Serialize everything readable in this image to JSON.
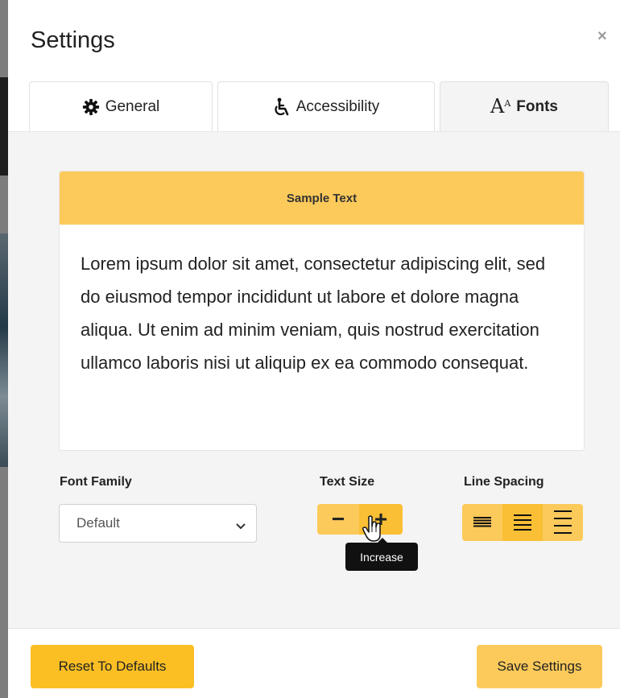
{
  "modal": {
    "title": "Settings",
    "close_label": "×"
  },
  "tabs": [
    {
      "label": "General",
      "icon": "gear-icon",
      "active": false
    },
    {
      "label": "Accessibility",
      "icon": "wheelchair-icon",
      "active": false
    },
    {
      "label": "Fonts",
      "icon": "font-size-icon",
      "active": true
    }
  ],
  "fonts_tab": {
    "icon_glyph_main": "A",
    "icon_glyph_sup": "A",
    "sample": {
      "header": "Sample Text",
      "body": "Lorem ipsum dolor sit amet, consectetur adipiscing elit, sed do eiusmod tempor incididunt ut labore et dolore magna aliqua. Ut enim ad minim veniam, quis nostrud exercitation ullamco laboris nisi ut aliquip ex ea commodo consequat."
    },
    "font_family": {
      "label": "Font Family",
      "value": "Default"
    },
    "text_size": {
      "label": "Text Size",
      "decrease": "−",
      "increase": "+",
      "tooltip": "Increase"
    },
    "line_spacing": {
      "label": "Line Spacing",
      "options": [
        "tight",
        "normal",
        "wide"
      ],
      "selected": "normal"
    }
  },
  "footer": {
    "reset_label": "Reset To Defaults",
    "save_label": "Save Settings"
  },
  "colors": {
    "accent": "#fcca5b",
    "accent_dark": "#fbbf24",
    "panel_bg": "#f4f4f4"
  }
}
